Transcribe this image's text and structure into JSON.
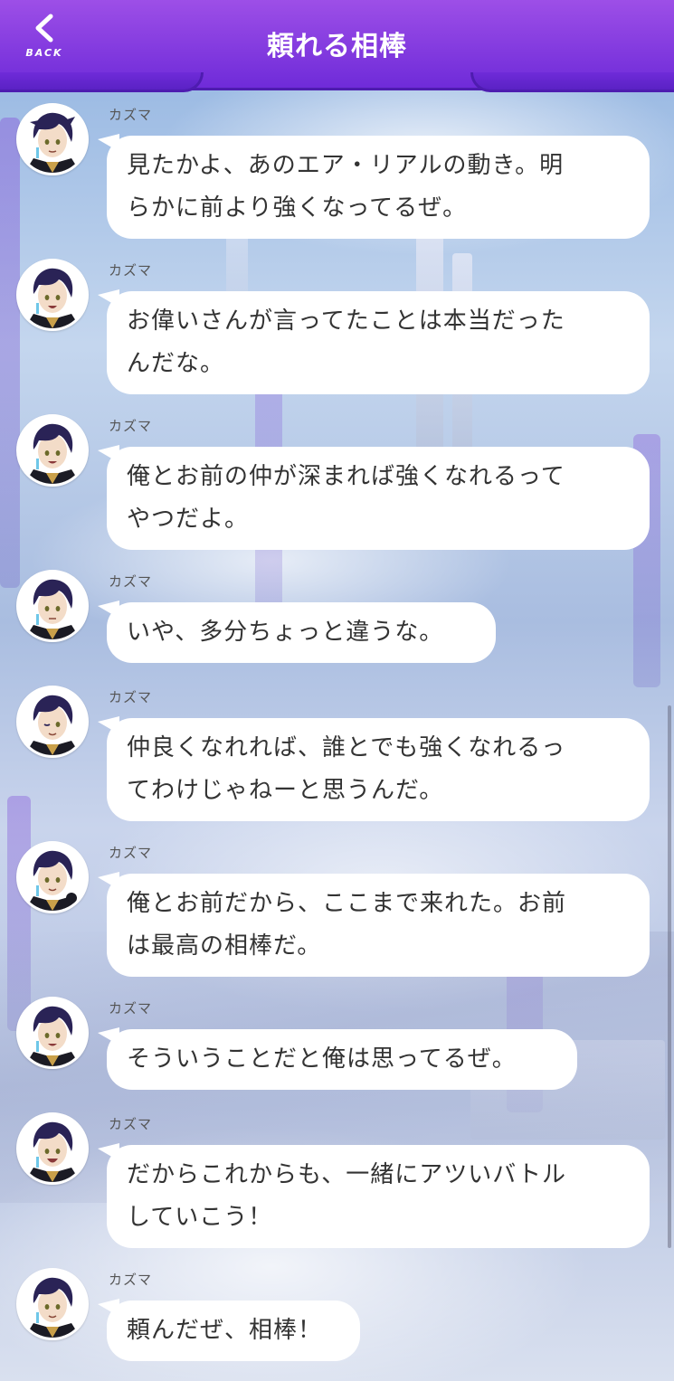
{
  "header": {
    "title": "頼れる相棒",
    "back_label": "BACK"
  },
  "messages": [
    {
      "sender": "カズマ",
      "lines": [
        "見たかよ、あのエア・リアルの動き。明",
        "らかに前より強くなってるぜ。"
      ]
    },
    {
      "sender": "カズマ",
      "lines": [
        "お偉いさんが言ってたことは本当だった",
        "んだな。"
      ]
    },
    {
      "sender": "カズマ",
      "lines": [
        "俺とお前の仲が深まれば強くなれるって",
        "やつだよ。"
      ]
    },
    {
      "sender": "カズマ",
      "lines": [
        "いや、多分ちょっと違うな。"
      ]
    },
    {
      "sender": "カズマ",
      "lines": [
        "仲良くなれれば、誰とでも強くなれるっ",
        "てわけじゃねーと思うんだ。"
      ]
    },
    {
      "sender": "カズマ",
      "lines": [
        "俺とお前だから、ここまで来れた。お前",
        "は最高の相棒だ。"
      ]
    },
    {
      "sender": "カズマ",
      "lines": [
        "そういうことだと俺は思ってるぜ。"
      ]
    },
    {
      "sender": "カズマ",
      "lines": [
        "だからこれからも、一緒にアツいバトル",
        "していこう！"
      ]
    },
    {
      "sender": "カズマ",
      "lines": [
        "頼んだぜ、相棒！"
      ]
    }
  ]
}
